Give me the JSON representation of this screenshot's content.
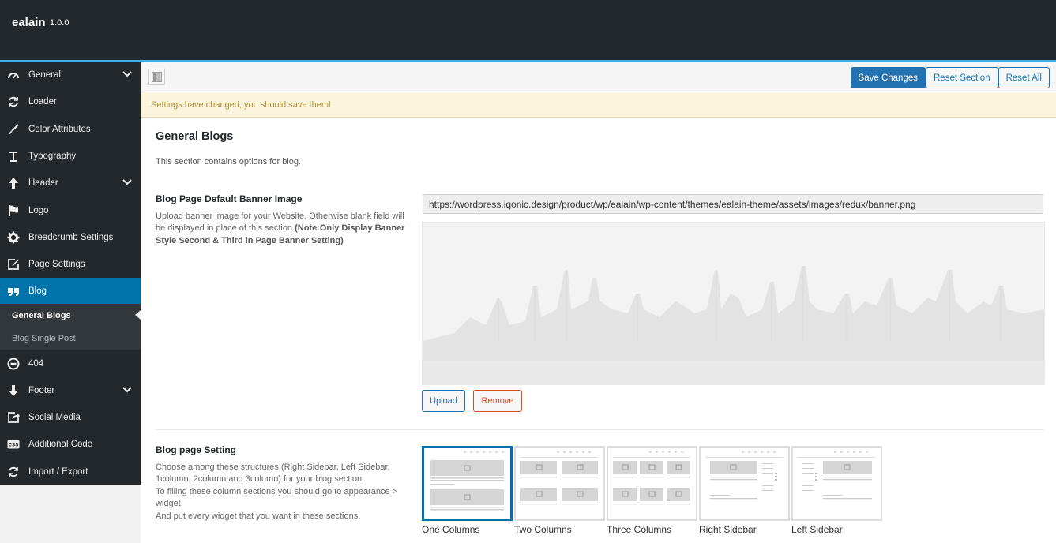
{
  "app": {
    "name": "ealain",
    "version": "1.0.0"
  },
  "sidebar": {
    "items": [
      {
        "label": "General",
        "icon": "dashboard-icon",
        "chevron": true
      },
      {
        "label": "Loader",
        "icon": "refresh-icon",
        "chevron": false
      },
      {
        "label": "Color Attributes",
        "icon": "brush-icon",
        "chevron": false
      },
      {
        "label": "Typography",
        "icon": "text-icon",
        "chevron": false
      },
      {
        "label": "Header",
        "icon": "arrow-up-icon",
        "chevron": true
      },
      {
        "label": "Logo",
        "icon": "flag-icon",
        "chevron": false
      },
      {
        "label": "Breadcrumb Settings",
        "icon": "gear-icon",
        "chevron": false
      },
      {
        "label": "Page Settings",
        "icon": "edit-icon",
        "chevron": false
      },
      {
        "label": "Blog",
        "icon": "quote-icon",
        "chevron": false
      },
      {
        "label": "404",
        "icon": "minus-circle-icon",
        "chevron": false
      },
      {
        "label": "Footer",
        "icon": "arrow-down-icon",
        "chevron": true
      },
      {
        "label": "Social Media",
        "icon": "share-icon",
        "chevron": false
      },
      {
        "label": "Additional Code",
        "icon": "css-icon",
        "chevron": false
      },
      {
        "label": "Import / Export",
        "icon": "refresh-icon",
        "chevron": false
      }
    ],
    "blog_sub": [
      {
        "label": "General Blogs"
      },
      {
        "label": "Blog Single Post"
      }
    ]
  },
  "toolbar": {
    "save_label": "Save Changes",
    "reset_section_label": "Reset Section",
    "reset_all_label": "Reset All"
  },
  "notice": "Settings have changed, you should save them!",
  "section": {
    "title": "General Blogs",
    "description": "This section contains options for blog."
  },
  "banner_field": {
    "title": "Blog Page Default Banner Image",
    "desc_plain": "Upload banner image for your Website. Otherwise blank field will be displayed in place of this section.",
    "desc_bold": "(Note:Only Display Banner Style Second & Third in Page Banner Setting)",
    "url": "https://wordpress.iqonic.design/product/wp/ealain/wp-content/themes/ealain-theme/assets/images/redux/banner.png",
    "upload_label": "Upload",
    "remove_label": "Remove"
  },
  "layout_field": {
    "title": "Blog page Setting",
    "desc_lines": [
      "Choose among these structures (Right Sidebar, Left Sidebar, 1column, 2column and 3column) for your blog section.",
      "To filling these column sections you should go to appearance > widget.",
      "And put every widget that you want in these sections."
    ],
    "options": [
      "One Columns",
      "Two Columns",
      "Three Columns",
      "Right Sidebar",
      "Left Sidebar"
    ],
    "selected": "One Columns"
  },
  "colors": {
    "accent": "#0073aa",
    "sidebar_bg": "#23282d",
    "notice_bg": "#fbf5dd",
    "remove": "#d54e21"
  }
}
